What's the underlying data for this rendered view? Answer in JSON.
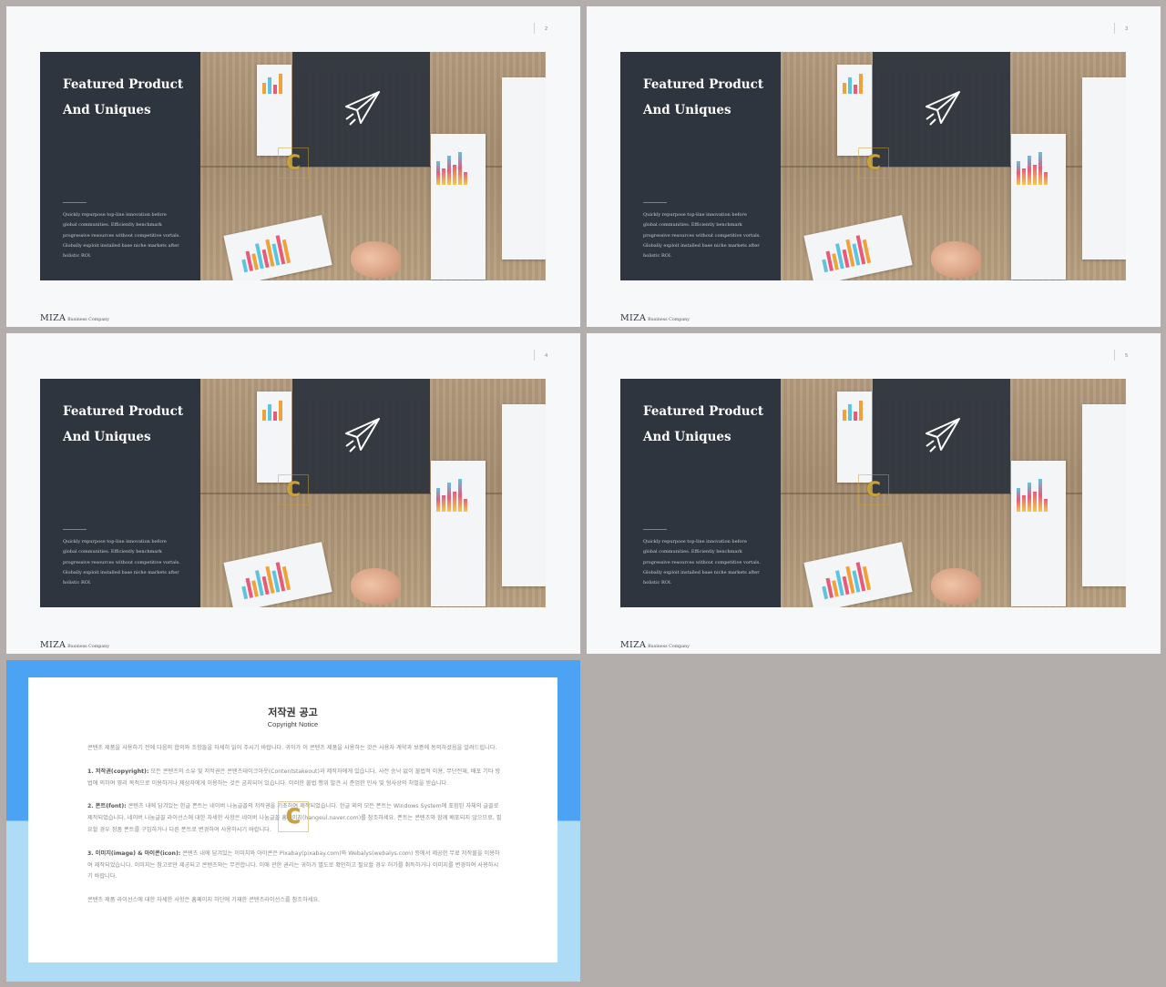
{
  "slides": [
    {
      "page": "2"
    },
    {
      "page": "3"
    },
    {
      "page": "4"
    },
    {
      "page": "5"
    }
  ],
  "slide_content": {
    "title_line1": "Featured Product",
    "title_line2": "And Uniques",
    "body": "Quickly repurpose top-line innovation before global communities. Efficiently benchmark progressive resources without competitive vortals. Globally exploit installed base niche markets after holistic ROI.",
    "logo_brand": "MIZA",
    "logo_sub": "Business Company",
    "plane_icon": "paper-plane-icon"
  },
  "copyright": {
    "title": "저작권 공고",
    "subtitle": "Copyright Notice",
    "intro": "콘텐츠 제품을 사용하기 전에 다음의 합의와 조항들을 자세히 읽어 주시기 바랍니다. 귀하가 이 콘텐츠 제품을 사용하는 것은 사용자 계약과 보증에 동의하셨음을 알려드립니다.",
    "s1_head": "1. 저작권(copyright):",
    "s1_text": " 모든 콘텐츠의 소유 및 저작권은 콘텐츠테이크아웃(Contentstakeout)과 제작자에게 있습니다. 사전 승낙 없이 불법적 이용, 무단전재, 배포 기타 방법에 의하여 영리 목적으로 이용하거나 제삼자에게 이용하는 것은 금지되어 있습니다. 이러한 불법 행위 발견 시 준엄한 민사 및 형사상의 처벌을 받습니다.",
    "s2_head": "2. 폰트(font):",
    "s2_text": " 콘텐츠 내에 담겨있는 한글 폰트는 네이버 나눔글꼴의 저작권을 기초하여 제작되었습니다. 한글 외의 모든 폰트는 Windows System에 포함된 자체의 글꼴로 제작되었습니다. 네이버 나눔글꼴 라이선스에 대한 자세한 사항은 네이버 나눔글꼴 홈페이지(hangeul.naver.com)를 참조하세요. 폰트는 콘텐츠와 함께 배포되지 않으므로, 필요할 경우 정품 폰트를 구입하거나 다른 폰트로 변경하여 사용하시기 바랍니다.",
    "s3_head": "3. 이미지(image) & 아이콘(icon):",
    "s3_text": " 콘텐츠 내에 담겨있는 이미지와 아이콘은 Pixabay(pixabay.com)와 Webalys(webalys.com) 등에서 제공한 무료 저작물을 이용하여 제작되었습니다. 이미지는 참고로만 제공되고 콘텐츠와는 무관합니다. 이에 관한 권리는 귀하가 별도로 확인하고 필요할 경우 허가를 취득하거나 이미지를 변경하여 사용하시기 바랍니다.",
    "outro": "콘텐츠 제품 라이선스에 대한 자세한 사항은 홈페이지 하단에 기재한 콘텐츠라이선스를 참조하세요."
  },
  "colors": {
    "panel": "#2f353e",
    "copy_top": "#4da3f3",
    "copy_bottom": "#aedcf7",
    "watermark": "#c9a23a"
  }
}
